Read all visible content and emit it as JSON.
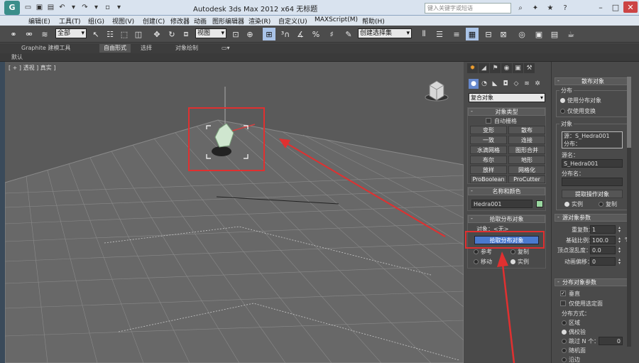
{
  "app": {
    "title": "Autodesk 3ds Max  2012 x64    无标题",
    "search_placeholder": "键入关键字或短语"
  },
  "menus": [
    "编辑(E)",
    "工具(T)",
    "组(G)",
    "视图(V)",
    "创建(C)",
    "修改器",
    "动画",
    "图形编辑器",
    "渲染(R)",
    "自定义(U)",
    "MAXScript(M)",
    "帮助(H)"
  ],
  "toolbar": {
    "filter_select": "全部",
    "coord_select": "视图",
    "selection_set": "创建选择集"
  },
  "ribbon": {
    "tabs": [
      "Graphite 建模工具",
      "自由形式",
      "选择",
      "对象绘制"
    ],
    "active_tab": "自由形式",
    "sub_label": "默认"
  },
  "viewport": {
    "label": "[ + ] 透视 ] 真实 ]"
  },
  "command_panel": {
    "category": "复合对象",
    "object_type": {
      "header": "对象类型",
      "autogrid": "自动栅格",
      "buttons": [
        "变形",
        "散布",
        "一致",
        "连接",
        "水滴网格",
        "图形合并",
        "布尔",
        "地形",
        "放样",
        "网格化",
        "ProBoolean",
        "ProCutter"
      ]
    },
    "name_color": {
      "header": "名称和颜色",
      "name_value": "Hedra001",
      "color": "#9ad8a0"
    },
    "pick": {
      "header": "拾取分布对象",
      "object_label": "对象：<无>",
      "pick_button": "拾取分布对象",
      "options": [
        "参考",
        "复制",
        "移动",
        "实例"
      ],
      "selected": "实例"
    }
  },
  "scatter_panel": {
    "header": "散布对象",
    "distribution": {
      "group": "分布",
      "options": [
        "使用分布对象",
        "仅使用变换"
      ],
      "selected": "使用分布对象"
    },
    "objects": {
      "group": "对象",
      "list": [
        "源：S_Hedra001",
        "分布："
      ],
      "source_name_label": "源名：",
      "source_name_value": "S_Hedra001",
      "dist_name_label": "分布名：",
      "extract_button": "提取操作对象",
      "instance": "实例",
      "copy": "复制"
    },
    "source_params": {
      "header": "源对象参数",
      "duplicates_label": "重复数：",
      "duplicates_value": "1",
      "base_scale_label": "基础比例：",
      "base_scale_value": "100.0",
      "base_scale_unit": "%",
      "vertex_chaos_label": "顶点混乱度：",
      "vertex_chaos_value": "0.0",
      "anim_offset_label": "动画偏移：",
      "anim_offset_value": "0"
    },
    "dist_params": {
      "header": "分布对象参数",
      "perpendicular": "垂直",
      "selected_faces": "仅使用选定面",
      "method_label": "分布方式：",
      "methods": [
        "区域",
        "偶校验",
        "跳过 N 个：",
        "随机面",
        "沿边"
      ],
      "selected_method": "偶校验",
      "skip_value": "0"
    }
  }
}
